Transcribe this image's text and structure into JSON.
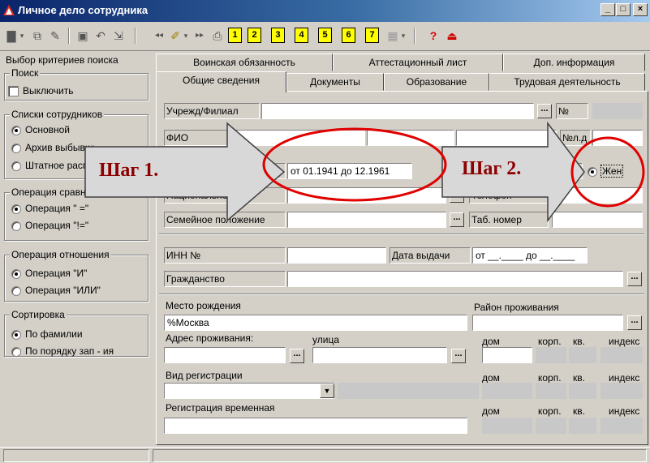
{
  "window": {
    "title": "Личное дело сотрудника",
    "buttons": [
      "_",
      "□",
      "×"
    ]
  },
  "toolbar": {
    "icons": [
      "new-doc-icon",
      "dropdown-arrow",
      "copy-icon",
      "edit-icon",
      "delete-icon",
      "undo-icon",
      "export-icon",
      "prev-icon",
      "filter-icon",
      "dropdown-arrow",
      "next-icon",
      "print-icon",
      "page-1-icon",
      "page-2-icon",
      "page-3-icon",
      "page-4-icon",
      "page-5-icon",
      "page-6-icon",
      "page-7-icon",
      "grid-icon",
      "dropdown-arrow",
      "help-icon",
      "exit-icon"
    ],
    "page_labels": [
      "1",
      "2",
      "3",
      "4",
      "5",
      "6",
      "7"
    ]
  },
  "left": {
    "title": "Выбор критериев поиска",
    "search": {
      "legend": "Поиск",
      "checkbox": "Выключить"
    },
    "lists": {
      "legend": "Списки сотрудников",
      "options": [
        "Основной",
        "Архив выбывших",
        "Штатное расписание"
      ],
      "selected": 0
    },
    "compare": {
      "legend": "Операция сравнения",
      "options": [
        "Операция \" =\"",
        "Операция \"!=\""
      ],
      "selected": 0
    },
    "relation": {
      "legend": "Операция отношения",
      "options": [
        "Операция \"И\"",
        "Операция \"ИЛИ\""
      ],
      "selected": 0
    },
    "sort": {
      "legend": "Сортировка",
      "options": [
        "По фамилии",
        "По порядку зап - ия"
      ],
      "selected": 0
    }
  },
  "tabs": {
    "row1": [
      "Воинская обязанность",
      "Аттестационный лист",
      "Доп. информация"
    ],
    "row2": [
      "Общие сведения",
      "Документы",
      "Образование",
      "Трудовая деятельность"
    ],
    "active": "Общие сведения"
  },
  "form": {
    "institution_label": "Учрежд/Филиал",
    "institution_value": "",
    "number_label": "№",
    "fio_label": "ФИО",
    "personal_no_label": "№л.д",
    "birth_range": "от 01.1941 до 12.1961",
    "gender_option": "Жен",
    "nationality_label": "Национальность",
    "phone_label": "Телефон",
    "marital_label": "Семейное положение",
    "tab_no_label": "Таб. номер",
    "inn_label": "ИНН №",
    "issue_date_label": "Дата выдачи",
    "issue_date_value": "от __.____ до __.____",
    "citizenship_label": "Гражданство",
    "birthplace_label": "Место рождения",
    "birthplace_value": "%Москва",
    "district_label": "Район проживания",
    "address_label": "Адрес проживания:",
    "street_label": "улица",
    "house_label": "дом",
    "corp_label": "корп.",
    "apt_label": "кв.",
    "index_label": "индекс",
    "reg_type_label": "Вид регистрации",
    "temp_reg_label": "Регистрация временная"
  },
  "annotations": {
    "step1": "Шаг 1.",
    "step2": "Шаг 2."
  },
  "colors": {
    "title_start": "#0a246a",
    "title_end": "#a6caf0",
    "highlight_red": "#e00000",
    "arrow_fill": "#d8d8d8",
    "step_text": "#8b0000"
  }
}
